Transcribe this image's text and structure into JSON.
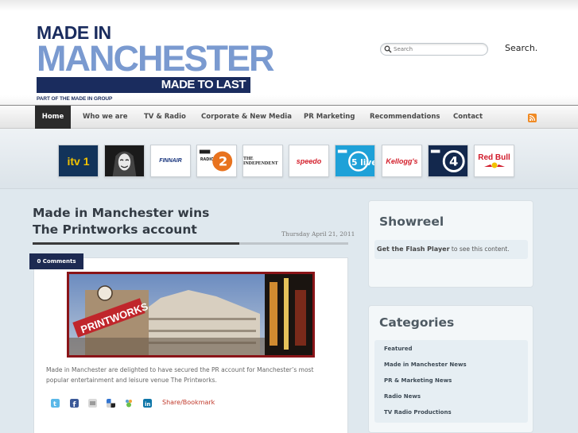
{
  "header": {
    "logo": {
      "line1": "MADE IN",
      "line2": "MANCHESTER",
      "tagline": "MADE TO LAST",
      "subline": "PART OF THE MADE IN GROUP"
    },
    "search": {
      "placeholder": "Search",
      "button_label": "Search."
    }
  },
  "nav": {
    "items": [
      {
        "label": "Home",
        "active": true
      },
      {
        "label": "Who we are"
      },
      {
        "label": "TV & Radio"
      },
      {
        "label": "Corporate & New Media"
      },
      {
        "label": "PR Marketing"
      },
      {
        "label": "Recommendations"
      },
      {
        "label": "Contact"
      }
    ]
  },
  "brands": [
    {
      "name": "itv-1-logo",
      "text": "itv 1",
      "bg": "#12335a",
      "fg": "#f2c200"
    },
    {
      "name": "hooded-mask-image",
      "text": "",
      "bg": "#222222",
      "fg": "#ffffff"
    },
    {
      "name": "finnair-logo",
      "text": "FINNAIR",
      "bg": "#ffffff",
      "fg": "#13307a"
    },
    {
      "name": "bbc-radio-2-logo",
      "text": "2",
      "bg": "#ffffff",
      "fg": "#e8731f"
    },
    {
      "name": "the-independent-logo",
      "text": "THE INDEPENDENT",
      "bg": "#ffffff",
      "fg": "#222222"
    },
    {
      "name": "speedo-logo",
      "text": "speedo",
      "bg": "#ffffff",
      "fg": "#d4202c"
    },
    {
      "name": "bbc-radio-5-live-logo",
      "text": "5 live",
      "bg": "#1ea1d8",
      "fg": "#ffffff"
    },
    {
      "name": "kelloggs-logo",
      "text": "Kellogg's",
      "bg": "#ffffff",
      "fg": "#d3202c"
    },
    {
      "name": "bbc-radio-4-logo",
      "text": "4",
      "bg": "#13284d",
      "fg": "#ffffff"
    },
    {
      "name": "red-bull-logo",
      "text": "Red Bull",
      "bg": "#ffffff",
      "fg": "#d11a2a"
    }
  ],
  "post": {
    "title_line1": "Made in Manchester wins",
    "title_line2": "The Printworks account",
    "date": "Thursday April 21, 2011",
    "comments": "0 Comments",
    "excerpt": "Made in Manchester are delighted to have secured the PR account for Manchester’s most popular entertainment and leisure venue The Printworks.",
    "share_label": "Share/Bookmark"
  },
  "sidebar": {
    "showreel": {
      "title": "Showreel",
      "flash_link": "Get the Flash Player",
      "flash_suffix": "to see this content."
    },
    "categories": {
      "title": "Categories",
      "items": [
        "Featured",
        "Made in Manchester News",
        "PR & Marketing News",
        "Radio News",
        "TV Radio Productions"
      ]
    }
  },
  "colors": {
    "brand_navy": "#1a2c5e",
    "brand_light_blue": "#7a9ad0",
    "nav_active_bg": "#2b2b2b",
    "share_link": "#c0392b"
  }
}
